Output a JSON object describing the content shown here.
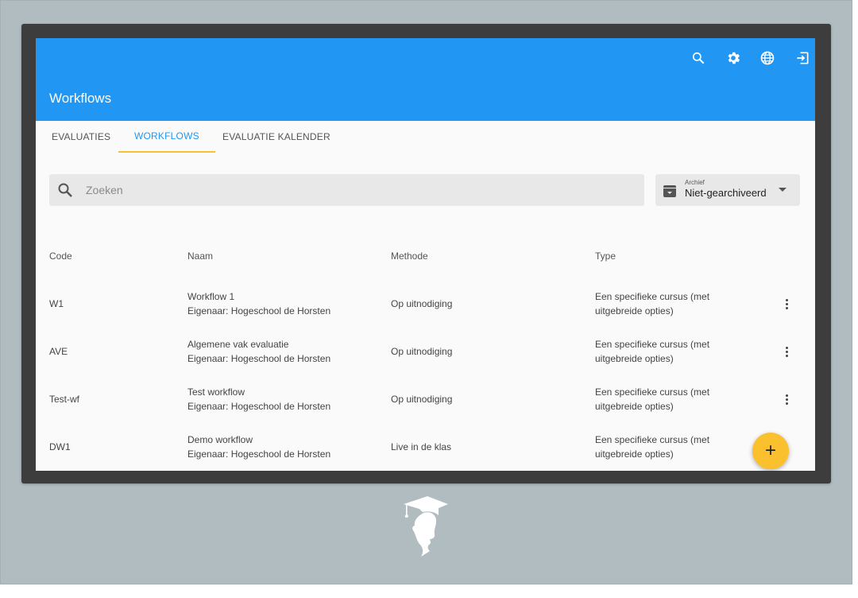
{
  "header": {
    "title": "Workflows"
  },
  "toolbar_icons": [
    "search-icon",
    "settings-icon",
    "language-icon",
    "logout-icon"
  ],
  "tabs": [
    {
      "label": "EVALUATIES",
      "active": false
    },
    {
      "label": "WORKFLOWS",
      "active": true
    },
    {
      "label": "EVALUATIE KALENDER",
      "active": false
    }
  ],
  "search": {
    "placeholder": "Zoeken",
    "value": ""
  },
  "archive": {
    "label": "Archief",
    "value": "Niet-gearchiveerd"
  },
  "table": {
    "columns": [
      "Code",
      "Naam",
      "Methode",
      "Type"
    ],
    "rows": [
      {
        "code": "W1",
        "name": "Workflow 1",
        "owner": "Eigenaar: Hogeschool de Horsten",
        "method": "Op uitnodiging",
        "type1": "Een specifieke cursus (met",
        "type2": "uitgebreide opties)"
      },
      {
        "code": "AVE",
        "name": "Algemene vak evaluatie",
        "owner": "Eigenaar: Hogeschool de Horsten",
        "method": "Op uitnodiging",
        "type1": "Een specifieke cursus (met",
        "type2": "uitgebreide opties)"
      },
      {
        "code": "Test-wf",
        "name": "Test workflow",
        "owner": "Eigenaar: Hogeschool de Horsten",
        "method": "Op uitnodiging",
        "type1": "Een specifieke cursus (met",
        "type2": "uitgebreide opties)"
      },
      {
        "code": "DW1",
        "name": "Demo workflow",
        "owner": "Eigenaar: Hogeschool de Horsten",
        "method": "Live in de klas",
        "type1": "Een specifieke cursus (met",
        "type2": "uitgebreide opties)"
      }
    ]
  },
  "fab": {
    "label": "+"
  },
  "colors": {
    "primary": "#2196f3",
    "accent": "#fbc02d",
    "backdrop": "#b0bcc0",
    "monitor": "#3d3d3d"
  }
}
